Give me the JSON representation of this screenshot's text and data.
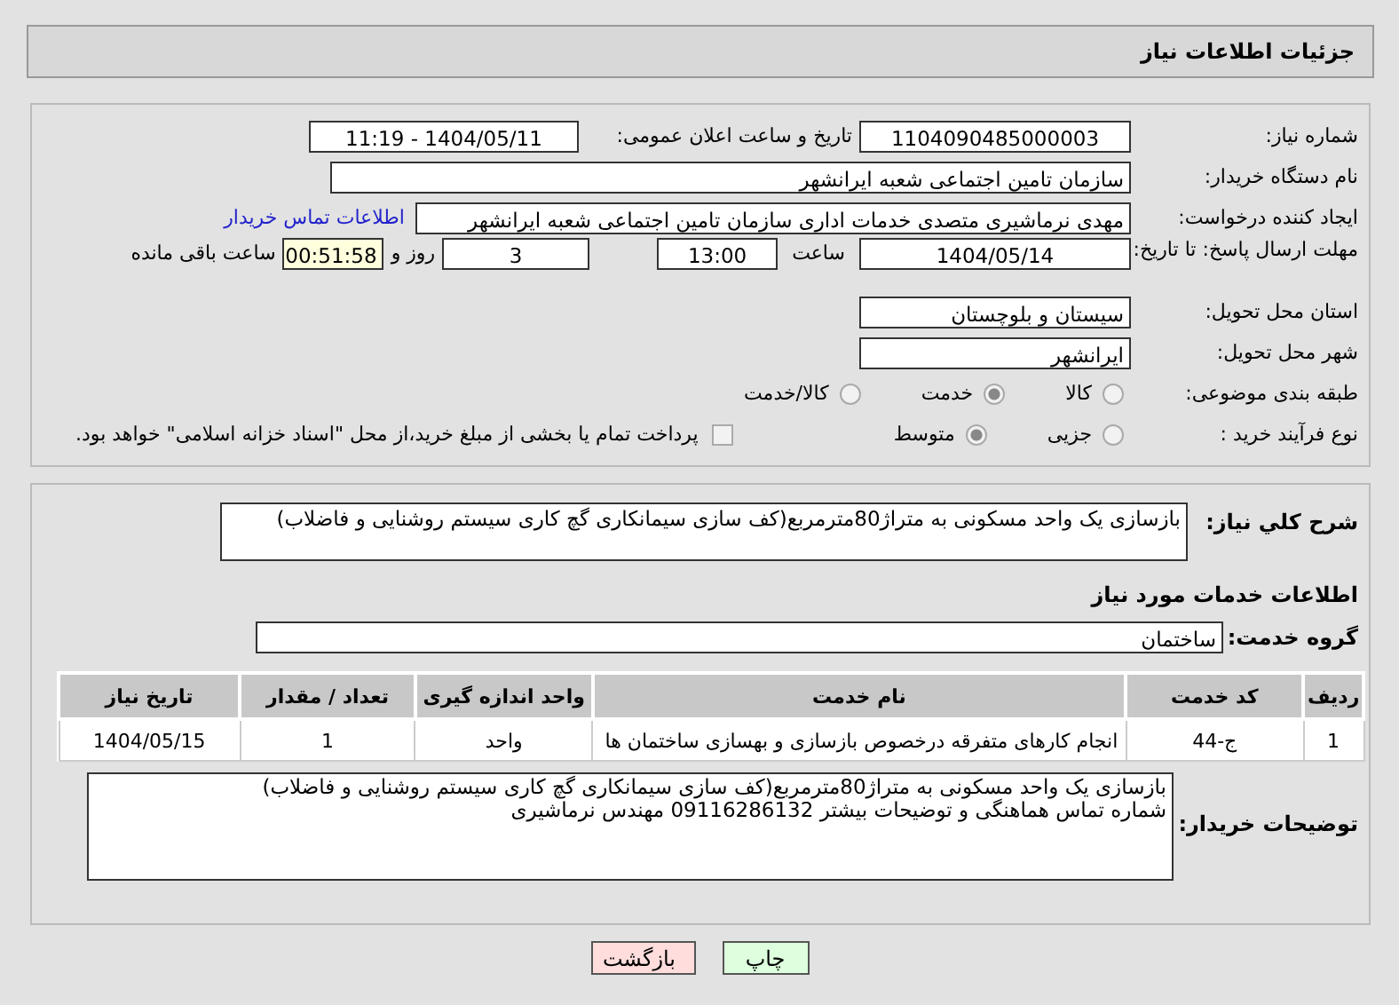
{
  "header": {
    "title": "جزئیات اطلاعات نیاز"
  },
  "details": {
    "need_number": {
      "label": "شماره نیاز:",
      "value": "1104090485000003"
    },
    "announce": {
      "label": "تاریخ و ساعت اعلان عمومی:",
      "value": "1404/05/11 - 11:19"
    },
    "buyer": {
      "label": "نام دستگاه خریدار:",
      "value": "سازمان تامین اجتماعی شعبه ایرانشهر"
    },
    "requester": {
      "label": "ایجاد کننده درخواست:",
      "value": "مهدی نرماشیری متصدی خدمات اداری سازمان تامین اجتماعی شعبه ایرانشهر",
      "link": "اطلاعات تماس خریدار"
    },
    "deadline": {
      "label": "مهلت ارسال پاسخ: تا تاریخ:",
      "date": "1404/05/14",
      "time_label": "ساعت",
      "time": "13:00",
      "days": "3",
      "days_label": "روز و",
      "remaining": "00:51:58",
      "remaining_label": "ساعت باقی مانده"
    },
    "province": {
      "label": "استان محل تحویل:",
      "value": "سیستان و بلوچستان"
    },
    "city": {
      "label": "شهر محل تحویل:",
      "value": "ایرانشهر"
    },
    "category": {
      "label": "طبقه بندی موضوعی:",
      "options": [
        {
          "label": "کالا",
          "selected": false
        },
        {
          "label": "خدمت",
          "selected": true
        },
        {
          "label": "کالا/خدمت",
          "selected": false
        }
      ]
    },
    "process": {
      "label": "نوع فرآیند خرید :",
      "options": [
        {
          "label": "جزیی",
          "selected": false
        },
        {
          "label": "متوسط",
          "selected": true
        }
      ],
      "payment": {
        "label": "پرداخت تمام یا بخشی از مبلغ خرید،از محل \"اسناد خزانه اسلامی\" خواهد بود.",
        "checked": false
      }
    }
  },
  "services": {
    "summary": {
      "label": "شرح کلي نياز:",
      "value": "بازسازی یک واحد مسکونی به متراژ80مترمربع(کف سازی سیمانکاری گچ کاری سیستم روشنایی و فاضلاب)"
    },
    "heading": "اطلاعات خدمات مورد نیاز",
    "group": {
      "label": "گروه خدمت:",
      "value": "ساختمان"
    },
    "table": {
      "columns": [
        "ردیف",
        "کد خدمت",
        "نام خدمت",
        "واحد اندازه گیری",
        "تعداد / مقدار",
        "تاریخ نیاز"
      ],
      "rows": [
        [
          "1",
          "ج-44",
          "انجام کارهای متفرقه درخصوص بازسازی و بهسازی ساختمان ها",
          "واحد",
          "1",
          "1404/05/15"
        ]
      ]
    },
    "notes": {
      "label": "توضیحات خریدار:",
      "lines": [
        "بازسازی یک واحد مسکونی به متراژ80مترمربع(کف سازی سیمانکاری گچ کاری سیستم روشنایی و فاضلاب)",
        "شماره تماس هماهنگی و توضیحات بیشتر 09116286132 مهندس نرماشیری"
      ]
    }
  },
  "buttons": [
    {
      "label": "چاپ",
      "kind": "print"
    },
    {
      "label": "بازگشت",
      "kind": "back"
    }
  ]
}
